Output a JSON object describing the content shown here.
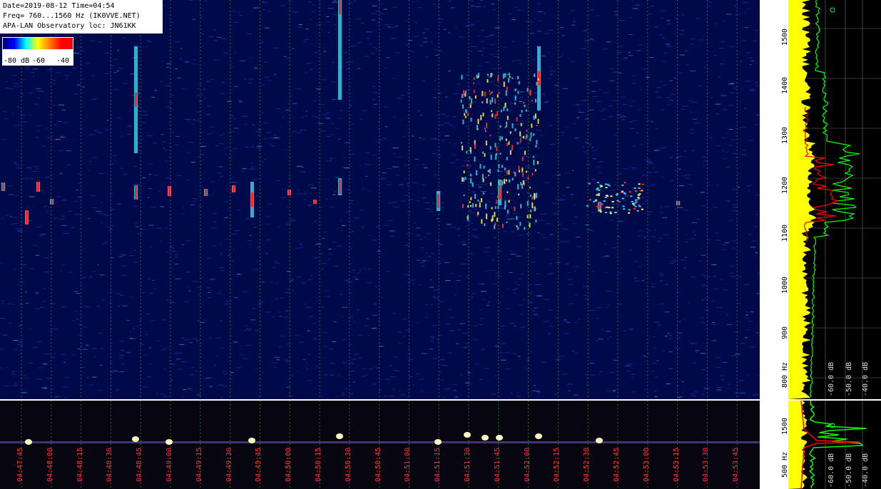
{
  "info": {
    "line1": "Date=2019-08-12 Time=04:54",
    "line2": "Freq= 760...1560 Hz (IK0VVE.NET)",
    "line3": "APA-LAN Observatory loc: JN61KK"
  },
  "legend": {
    "l1": "-80 dB",
    "l2": "-60",
    "l3": "-40"
  },
  "freq_ticks": [
    "1500",
    "1400",
    "1300",
    "1200",
    "1100",
    "1000",
    "900",
    "800 Hz"
  ],
  "freq_ticks_bottom": [
    "1500",
    "500 Hz"
  ],
  "db_labels": [
    "-60.0 dB",
    "-50.0 dB",
    "-40.0 dB"
  ],
  "time_ticks": [
    "04:47:45",
    "04:48:00",
    "04:48:15",
    "04:48:30",
    "04:48:45",
    "04:49:00",
    "04:49:15",
    "04:49:30",
    "04:49:45",
    "04:50:00",
    "04:50:15",
    "04:50:30",
    "04:50:45",
    "04:51:00",
    "04:51:15",
    "04:51:30",
    "04:51:45",
    "04:52:00",
    "04:52:15",
    "04:52:30",
    "04:52:45",
    "04:53:00",
    "04:53:15",
    "04:53:30",
    "04:53:45"
  ],
  "colors": {
    "background": "#000a4a",
    "grid": "#2a8a2a",
    "tick_text": "#ff3030",
    "peak_trace": "#ff0000",
    "avg_trace": "#00ff00",
    "max_trace": "#ffff00"
  }
}
